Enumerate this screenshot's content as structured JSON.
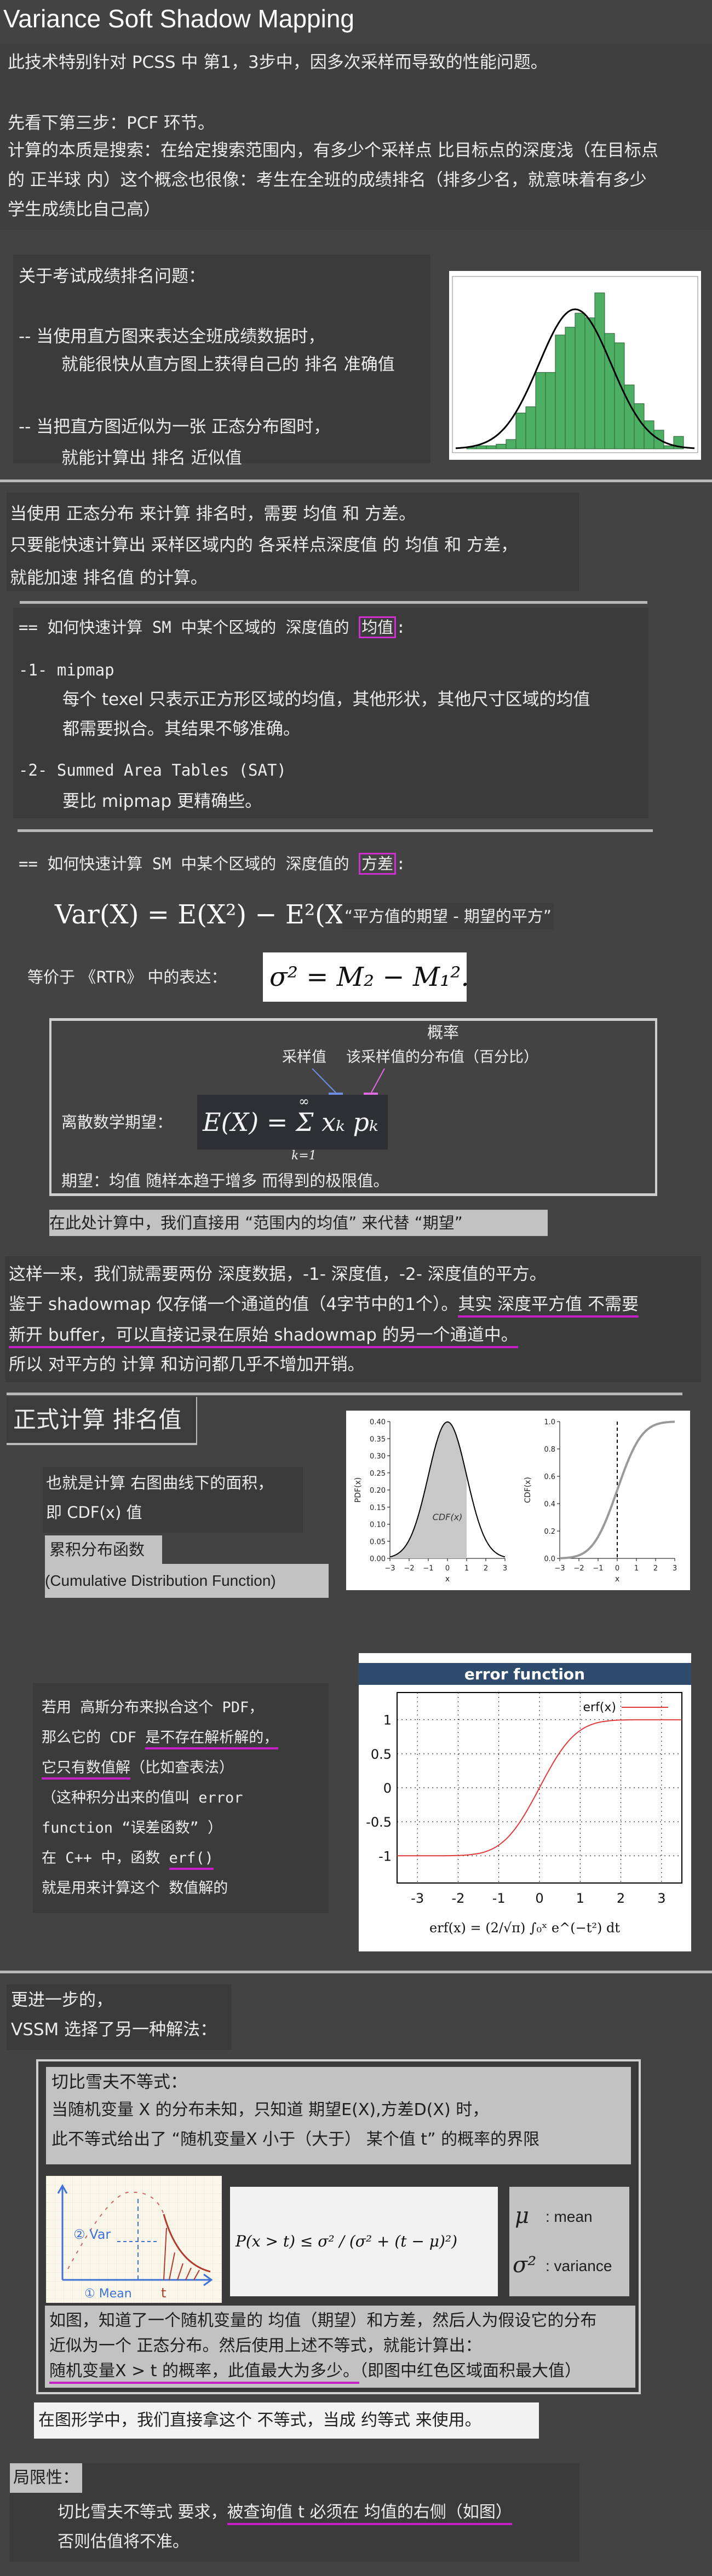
{
  "title": "Variance Soft Shadow Mapping",
  "intro": {
    "line1": "此技术特别针对 PCSS 中 第1，3步中，因多次采样而导致的性能问题。",
    "line2": "先看下第三步：PCF 环节。",
    "line3": "计算的本质是搜索：在给定搜索范围内，有多少个采样点 比目标点的深度浅（在目标点",
    "line4": "的 正半球 内）这个概念也很像：考生在全班的成绩排名（排多少名，就意味着有多少",
    "line5": "学生成绩比自己高）"
  },
  "exam": {
    "heading": "关于考试成绩排名问题：",
    "item1a": "-- 当使用直方图来表达全班成绩数据时，",
    "item1b": "就能很快从直方图上获得自己的 排名 准确值",
    "item2a": "-- 当把直方图近似为一张 正态分布图时，",
    "item2b": "就能计算出 排名 近似值",
    "histogram": [
      1,
      2,
      2,
      3,
      6,
      23,
      27,
      49,
      49,
      73,
      78,
      87,
      84,
      100,
      74,
      68,
      41,
      29,
      18,
      12,
      2,
      8
    ]
  },
  "normal": {
    "line1": "当使用 正态分布 来计算 排名时，需要 均值 和 方差。",
    "line2": "只要能快速计算出 采样区域内的 各采样点深度值 的 均值 和 方差，",
    "line3": "就能加速 排名值 的计算。"
  },
  "mean_section": {
    "heading_prefix": "== 如何快速计算 SM 中某个区域的 深度值的 ",
    "heading_key": "均值",
    "heading_suffix": ":",
    "m1_title": "-1- mipmap",
    "m1_line1": "每个 texel 只表示正方形区域的均值，其他形状，其他尺寸区域的均值",
    "m1_line2": "都需要拟合。其结果不够准确。",
    "m2_title": "-2- Summed Area Tables (SAT)",
    "m2_line1": "要比 mipmap 更精确些。"
  },
  "var_section": {
    "heading_prefix": "== 如何快速计算 SM 中某个区域的 深度值的 ",
    "heading_key": "方差",
    "heading_suffix": ":",
    "formula": "Var(X) = E(X²) − E²(X)",
    "quote": "“平方值的期望 - 期望的平方”",
    "rtr_label": "等价于 《RTR》 中的表达：",
    "rtr_formula": "σ² = M₂ − M₁².",
    "prob_label": "概率",
    "sample_label": "采样值",
    "dist_label": "该采样值的分布值（百分比）",
    "discrete_label": "离散数学期望：",
    "expect_formula": "E(X) = Σ xₖ pₖ",
    "sum_top": "∞",
    "sum_bottom": "k=1",
    "expect_note": "期望：均值 随样本趋于增多 而得到的极限值。",
    "replace_note": "在此处计算中，我们直接用 “范围内的均值” 来代替 “期望”"
  },
  "storage": {
    "line1": "这样一来，我们就需要两份 深度数据，-1- 深度值，-2- 深度值的平方。",
    "line2a": "鉴于 shadowmap 仅存储一个通道的值（4字节中的1个）。",
    "line2b": "其实 深度平方值 不需要",
    "line3": "新开 buffer，可以直接记录在原始 shadowmap 的另一个通道中。",
    "line4": "所以 对平方的 计算 和访问都几乎不增加开销。"
  },
  "rank": {
    "heading": "正式计算 排名值",
    "line1": "也就是计算 右图曲线下的面积，",
    "line2": "即 CDF(x) 值",
    "cdf_cn": "累积分布函数",
    "cdf_en": "(Cumulative Distribution Function)",
    "pdf_chart": {
      "ylabel": "PDF(x)",
      "xlabel": "x",
      "yticks": [
        "0.00",
        "0.05",
        "0.10",
        "0.15",
        "0.20",
        "0.25",
        "0.30",
        "0.35",
        "0.40"
      ],
      "xticks": [
        "−3",
        "−2",
        "−1",
        "0",
        "1",
        "2",
        "3"
      ],
      "area_label": "CDF(x)",
      "shade_to": 1
    },
    "cdf_chart": {
      "ylabel": "CDF(x)",
      "xlabel": "x",
      "yticks": [
        "0.0",
        "0.2",
        "0.4",
        "0.6",
        "0.8",
        "1.0"
      ],
      "xticks": [
        "−3",
        "−2",
        "−1",
        "0",
        "1",
        "2",
        "3"
      ],
      "marker_x": 0
    }
  },
  "gauss": {
    "line1": "若用 高斯分布来拟合这个 PDF，",
    "line2a": "那么它的 CDF ",
    "line2b": "是不存在解析解的，",
    "line3a": "它只有数值解",
    "line3b": "（比如查表法）",
    "line4": "（这种积分出来的值叫 error",
    "line5": "function “误差函数” ）",
    "line6a": "在 C++ 中，函数 ",
    "line6b": "erf()",
    "line7": "就是用来计算这个 数值解的",
    "erf_chart": {
      "title": "error function",
      "legend": "erf(x)",
      "yticks": [
        "-1",
        "-0.5",
        "0",
        "0.5",
        "1"
      ],
      "xticks": [
        "-3",
        "-2",
        "-1",
        "0",
        "1",
        "2",
        "3"
      ],
      "formula": "erf(x) = (2/√π) ∫₀ˣ e^(−t²) dt",
      "line_color": "#e03a3a"
    }
  },
  "vssm": {
    "line1": "更进一步的，",
    "line2": "VSSM 选择了另一种解法：",
    "cheb_title": "切比雪夫不等式：",
    "cheb_line1": "当随机变量 X 的分布未知，只知道 期望E(X),方差D(X) 时，",
    "cheb_line2": "此不等式给出了 “随机变量X 小于（大于） 某个值 t” 的概率的界限",
    "sketch_var": "② Var",
    "sketch_mean": "① Mean",
    "sketch_t": "t",
    "ineq_formula": "P(x > t) ≤ σ² / (σ² + (t − μ)²)",
    "mu_sym": "μ",
    "mu_label": ": mean",
    "sigma_sym": "σ²",
    "sigma_label": ": variance",
    "explain1": "如图，知道了一个随机变量的 均值（期望）和方差，然后人为假设它的分布",
    "explain2": "近似为一个 正态分布。然后使用上述不等式，就能计算出：",
    "explain3a": "随机变量X > t 的概率，此值最大为多少。",
    "explain3b": "（即图中红色区域面积最大值）",
    "graphics_note": "在图形学中，我们直接拿这个 不等式，当成 约等式 来使用。"
  },
  "limits": {
    "heading": "局限性：",
    "line1a": "切比雪夫不等式 要求，",
    "line1b": "被查询值 t 必须在 均值的右侧（如图）",
    "line2": "否则估值将不准。"
  },
  "colors": {
    "background": "#434343",
    "highlight": "#d12ed1",
    "histogram_bar": "#4caf63"
  }
}
